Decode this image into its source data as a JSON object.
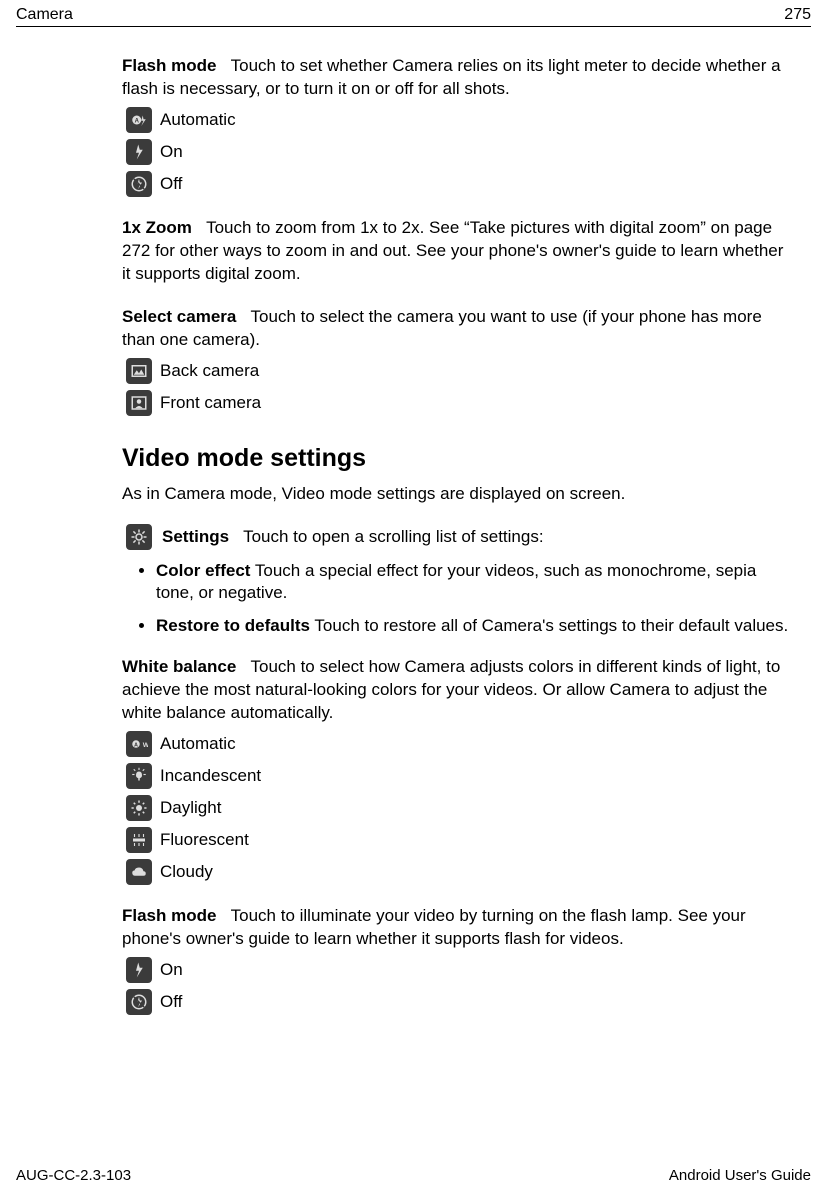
{
  "header": {
    "left": "Camera",
    "right": "275"
  },
  "flash_mode": {
    "term": "Flash mode",
    "desc": "Touch to set whether Camera relies on its light meter to decide whether a flash is necessary, or to turn it on or off for all shots.",
    "options": {
      "automatic": "Automatic",
      "on": "On",
      "off": "Off"
    }
  },
  "zoom": {
    "term": "1x Zoom",
    "desc": "Touch to zoom from 1x to 2x. See “Take pictures with digital zoom” on page 272 for other ways to zoom in and out. See your phone's owner's guide to learn whether it supports digital zoom."
  },
  "select_camera": {
    "term": "Select camera",
    "desc": "Touch to select the camera you want to use (if your phone has more than one camera).",
    "options": {
      "back": "Back camera",
      "front": "Front camera"
    }
  },
  "video_heading": "Video mode settings",
  "video_intro": "As in Camera mode, Video mode settings are displayed on screen.",
  "settings": {
    "label": "Settings",
    "desc": "Touch to open a scrolling list of settings:"
  },
  "bullets": {
    "color_effect": {
      "term": "Color effect",
      "desc": "Touch a special effect for your videos, such as monochrome, sepia tone, or negative."
    },
    "restore": {
      "term": "Restore to defaults",
      "desc": "Touch to restore all of Camera's settings to their default values."
    }
  },
  "white_balance": {
    "term": "White balance",
    "desc": "Touch to select how Camera adjusts colors in different kinds of light, to achieve the most natural-looking colors for your videos. Or allow Camera to adjust the white balance automatically.",
    "options": {
      "automatic": "Automatic",
      "incandescent": "Incandescent",
      "daylight": "Daylight",
      "fluorescent": "Fluorescent",
      "cloudy": "Cloudy"
    }
  },
  "flash_mode_video": {
    "term": "Flash mode",
    "desc": "Touch to illuminate your video by turning on the flash lamp. See your phone's owner's guide to learn whether it supports flash for videos.",
    "options": {
      "on": "On",
      "off": "Off"
    }
  },
  "footer": {
    "left": "AUG-CC-2.3-103",
    "right": "Android User's Guide"
  }
}
